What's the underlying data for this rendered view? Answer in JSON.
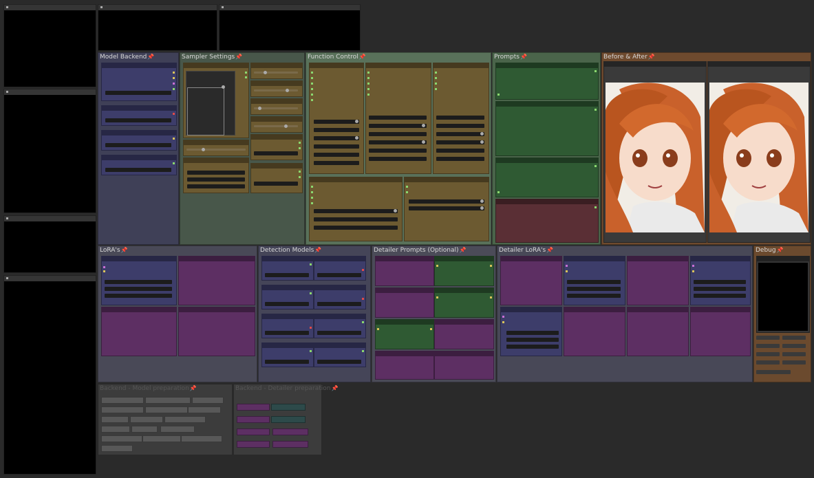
{
  "groups": {
    "model_backend": "Model Backend",
    "sampler_settings": "Sampler Settings",
    "function_control": "Function Control",
    "prompts": "Prompts",
    "before_after": "Before & After",
    "loras": "LoRA's",
    "detection_models": "Detection Models",
    "detailer_prompts": "Detailer Prompts (Optional)",
    "detailer_loras": "Detailer LoRA's",
    "debug": "Debug",
    "backend_model_pipe": "Backend - Model preparation",
    "backend_detailer_pipe": "Backend - Detailer preparation"
  },
  "pin_icon": "pin-icon",
  "colors": {
    "background": "#2a2a2a",
    "pin": "#e23b3b",
    "model_group": "#3f4057",
    "sampler_group": "#48574a",
    "function_group": "#59715a",
    "before_after_group": "#6e4a2e"
  }
}
